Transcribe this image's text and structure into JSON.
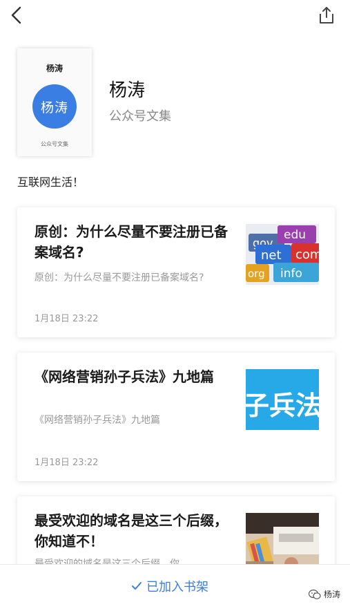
{
  "cover": {
    "title": "杨涛",
    "circle_text": "杨涛",
    "subtitle": "公众号文集"
  },
  "profile": {
    "name": "杨涛",
    "subtitle": "公众号文集",
    "bio": "互联网生活！"
  },
  "articles": [
    {
      "title": "原创：为什么尽量不要注册已备案域名?",
      "summary": "原创：为什么尽量不要注册已备案域名?",
      "date": "1月18日 23:22",
      "thumb_words": [
        "gov",
        "edu",
        "net",
        "com",
        "org",
        "info"
      ]
    },
    {
      "title": "《网络营销孙子兵法》九地篇",
      "summary": "《网络营销孙子兵法》九地篇",
      "date": "1月18日 23:22",
      "thumb_text": "子兵法"
    },
    {
      "title": "最受欢迎的域名是这三个后缀，你知道不！",
      "summary": "最受欢迎的域名是这三个后缀，你"
    }
  ],
  "bottom": {
    "shelf_label": "已加入书架",
    "watermark": "杨涛"
  },
  "colors": {
    "accent": "#3a7de3",
    "muted_text": "#999999"
  },
  "icons": {
    "back": "chevron-left-icon",
    "share": "share-icon",
    "check": "check-icon",
    "wechat": "wechat-icon"
  }
}
